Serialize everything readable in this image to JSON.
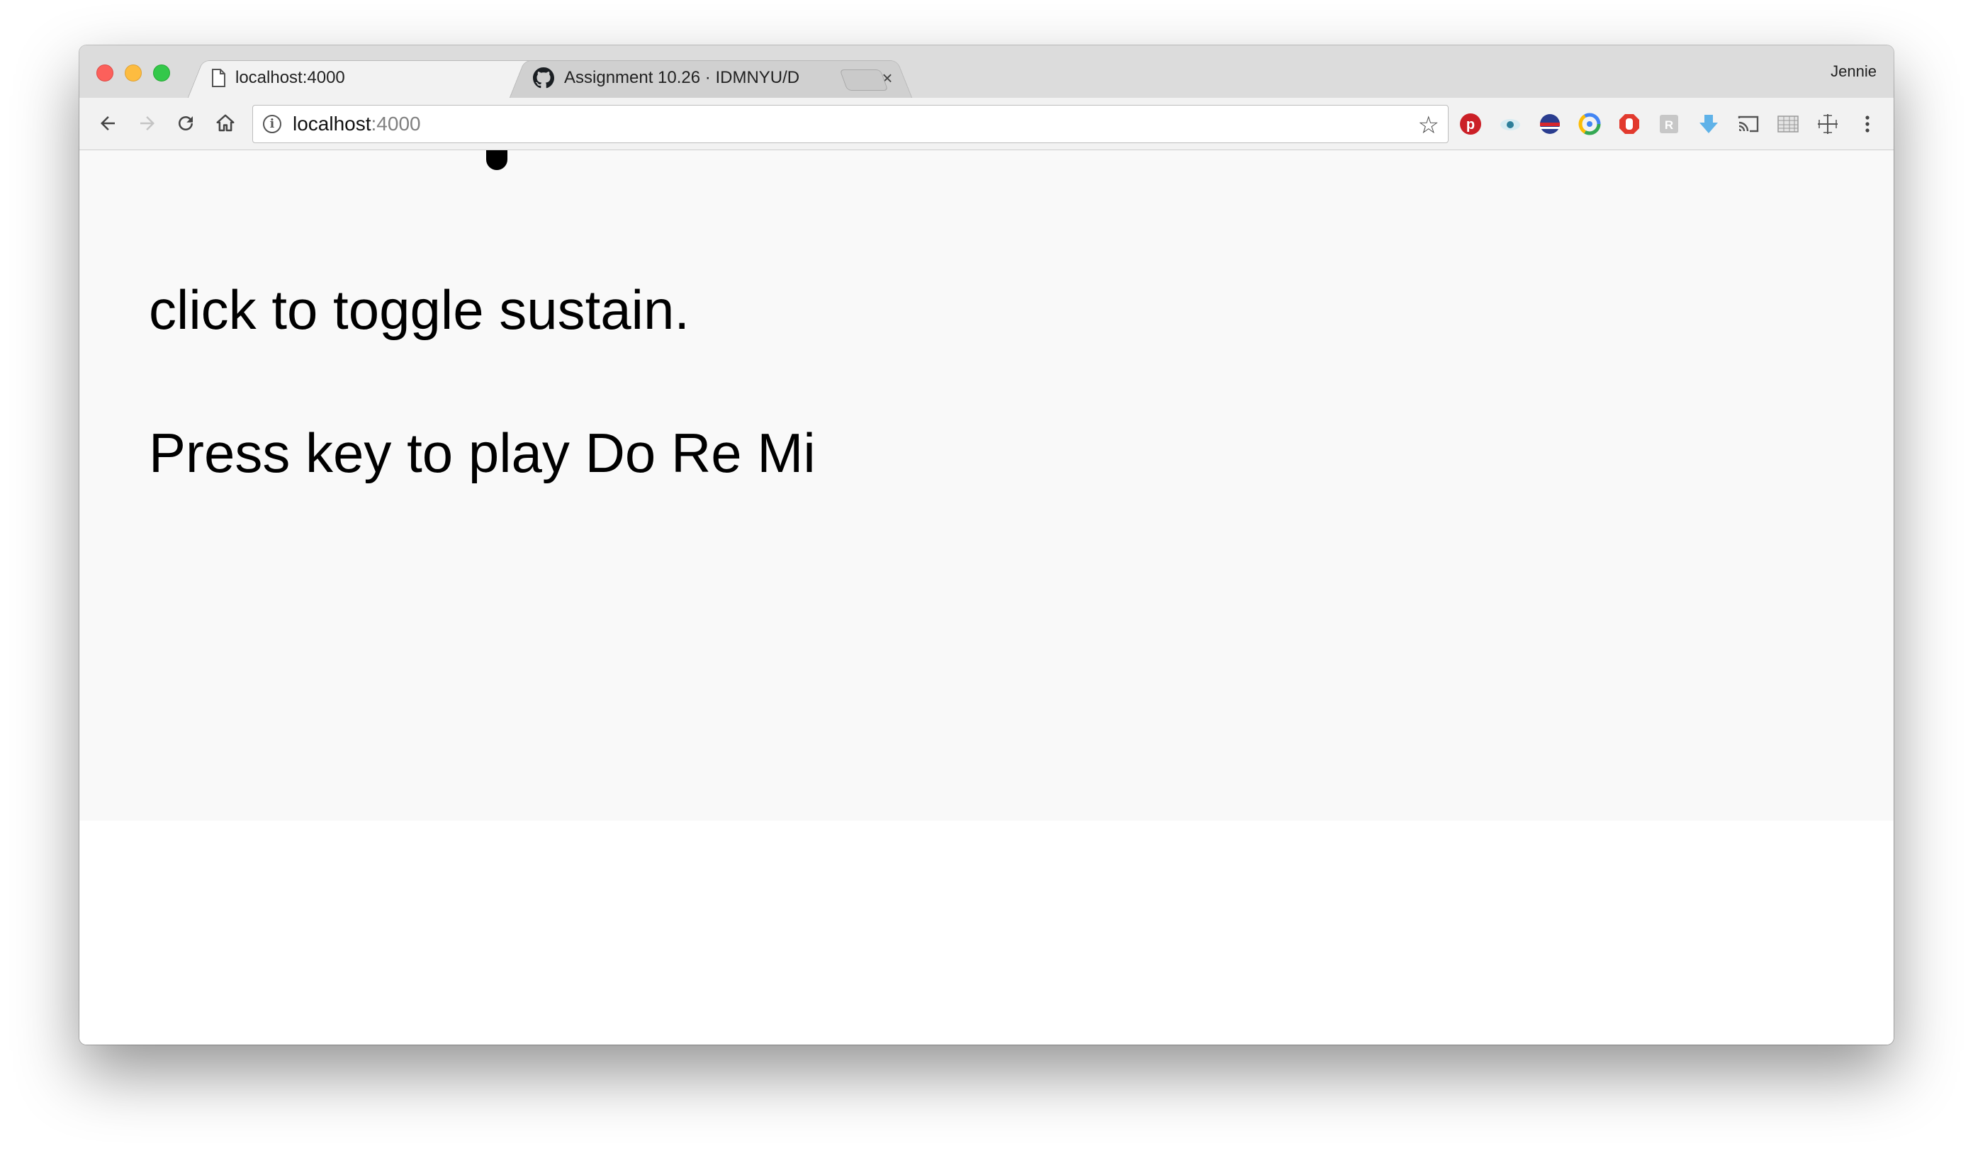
{
  "browser": {
    "profile_name": "Jennie",
    "tabs": [
      {
        "title": "localhost:4000",
        "active": true,
        "icon": "page-icon",
        "audio": true
      },
      {
        "title": "Assignment 10.26 · IDMNYU/D",
        "active": false,
        "icon": "github-icon"
      }
    ],
    "address": {
      "host": "localhost",
      "port": ":4000"
    },
    "extensions": [
      "pinterest-icon",
      "eye-icon",
      "globe-icon",
      "chrome-circle-icon",
      "stop-hand-icon",
      "puzzle-icon",
      "download-arrow-icon",
      "cast-icon",
      "grid-icon",
      "crosshair-icon",
      "menu-icon"
    ]
  },
  "page": {
    "line1": "click to toggle sustain.",
    "line2": "Press key to play Do Re Mi"
  },
  "colors": {
    "page_bg": "#f9f9f9",
    "tabstrip_bg": "#dcdcdc",
    "toolbar_bg": "#f2f2f2"
  }
}
